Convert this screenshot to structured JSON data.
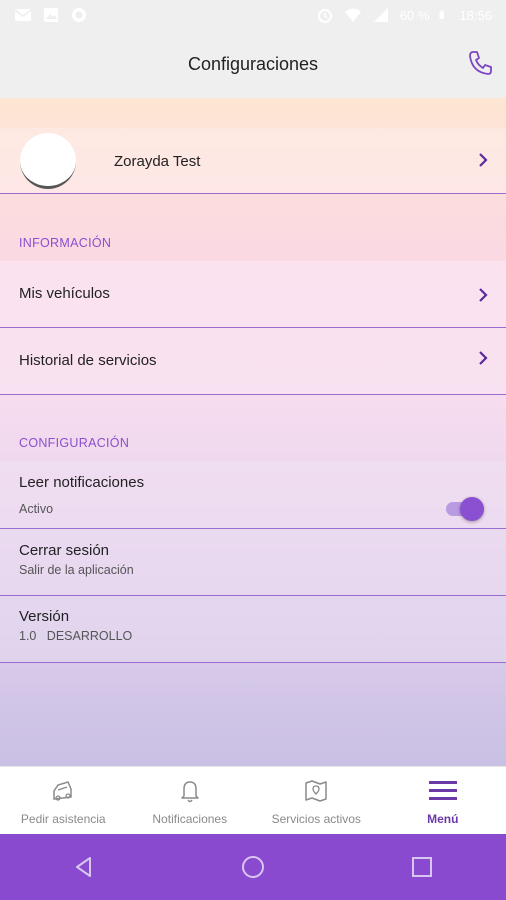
{
  "status_bar": {
    "battery": "60 %",
    "time": "18:56",
    "icons": [
      "mail-icon",
      "image-icon",
      "whatsapp-icon",
      "alarm-icon",
      "wifi-icon",
      "signal-icon"
    ]
  },
  "header": {
    "title": "Configuraciones",
    "phone_icon": "phone-icon"
  },
  "profile": {
    "name": "Zorayda Test"
  },
  "informacion": {
    "section_label": "INFORMACIÓN",
    "items": [
      {
        "label": "Mis vehículos"
      },
      {
        "label": "Historial de servicios"
      }
    ]
  },
  "configuracion": {
    "section_label": "CONFIGURACIÓN",
    "leer": {
      "title": "Leer notificaciones",
      "subtitle": "Activo",
      "enabled": true
    },
    "cerrar": {
      "title": "Cerrar sesión",
      "subtitle": "Salir de la aplicación"
    },
    "version": {
      "title": "Versión",
      "subtitle": "1.0   DESARROLLO"
    }
  },
  "bottom_nav": {
    "items": [
      {
        "label": "Pedir asistencia",
        "icon": "car-crash-icon",
        "active": false
      },
      {
        "label": "Notificaciones",
        "icon": "bell-icon",
        "active": false
      },
      {
        "label": "Servicios activos",
        "icon": "map-icon",
        "active": false
      },
      {
        "label": "Menú",
        "icon": "menu-icon",
        "active": true
      }
    ]
  },
  "colors": {
    "accent": "#8a4ad0",
    "active_nav": "#6c3aa8",
    "section_label": "#8a4fd0"
  }
}
